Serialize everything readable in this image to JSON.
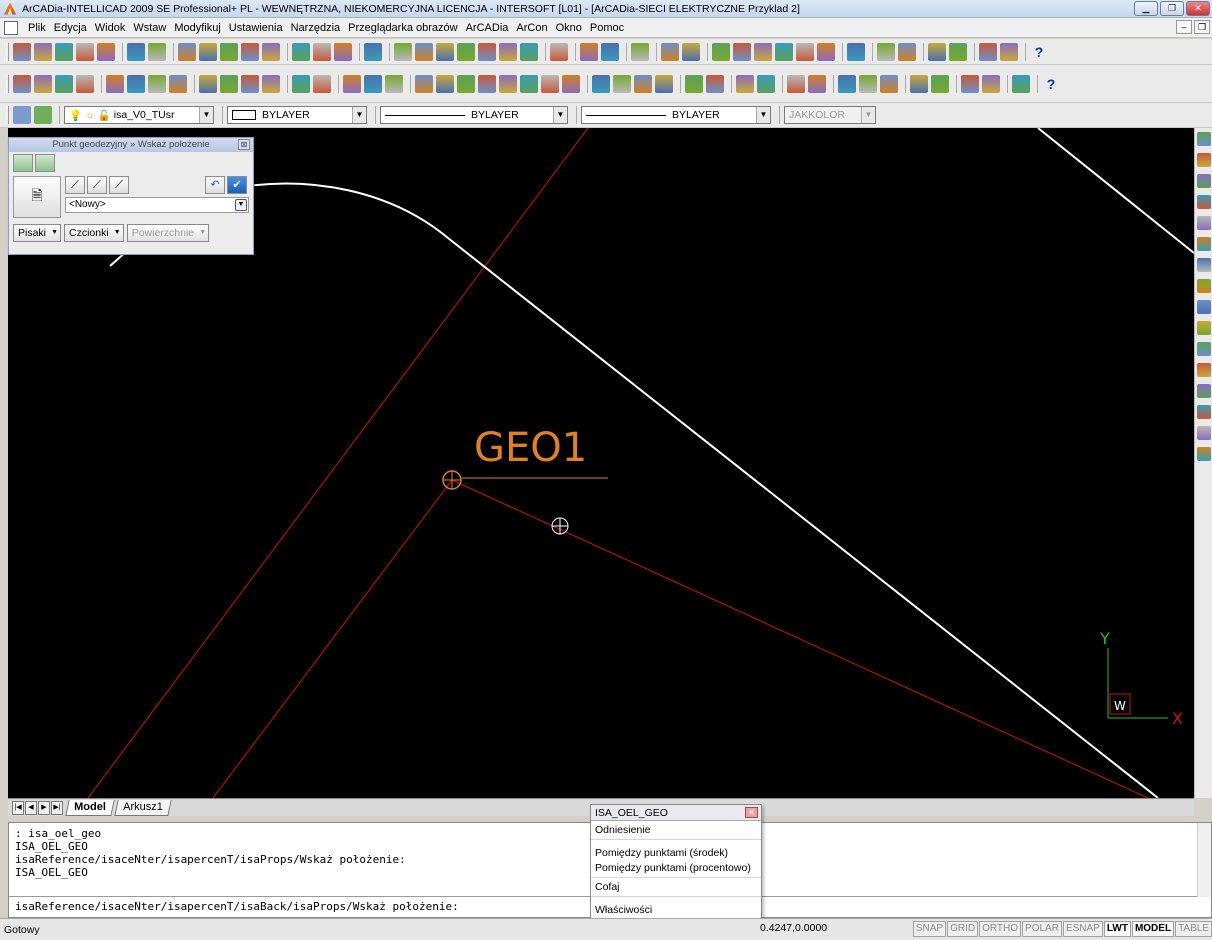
{
  "window": {
    "title": "ArCADia-INTELLICAD 2009 SE Professional+ PL - WEWNĘTRZNA, NIEKOMERCYJNA LICENCJA - INTERSOFT [L01] - [ArCADia-SIECI ELEKTRYCZNE Przyklad 2]",
    "min_label": "▁",
    "max_label": "❐",
    "close_label": "✕"
  },
  "menu": {
    "items": [
      "Plik",
      "Edycja",
      "Widok",
      "Wstaw",
      "Modyfikuj",
      "Ustawienia",
      "Narzędzia",
      "Przeglądarka obrazów",
      "ArCADia",
      "ArCon",
      "Okno",
      "Pomoc"
    ],
    "mdi_min": "–",
    "mdi_restore": "❐"
  },
  "toolbar4": {
    "layer_value": "isa_V0_TUsr",
    "color_value": "BYLAYER",
    "linetype_value": "BYLAYER",
    "lineweight_value": "BYLAYER",
    "plotstyle_value": "JAKKOLOR"
  },
  "float_panel": {
    "title": "Punkt geodezyjny » Wskaż położenie",
    "close": "⊠",
    "combo_value": "<Nowy>",
    "pisaki": "Pisaki",
    "czcionki": "Czcionki",
    "powierzchnie": "Powierzchnie",
    "undo_icon": "↶",
    "ok_icon": "✔"
  },
  "drawing": {
    "label": "GEO1",
    "ucs_y": "Y",
    "ucs_x": "X",
    "ucs_w": "W",
    "accent_red": "#d01010",
    "accent_orange": "#e08020"
  },
  "tabs": {
    "model": "Model",
    "sheet1": "Arkusz1"
  },
  "cmdline": {
    "history": [
      ": isa_oel_geo",
      "ISA_OEL_GEO",
      "isaReference/isaceNter/isapercenT/isaProps/Wskaż położenie:",
      "ISA_OEL_GEO"
    ],
    "prompt": "isaReference/isaceNter/isapercenT/isaBack/isaProps/Wskaż położenie:"
  },
  "popup": {
    "title": "ISA_OEL_GEO",
    "items": [
      "Odniesienie",
      "Pomiędzy punktami (środek)",
      "Pomiędzy punktami (procentowo)",
      "Cofaj",
      "Właściwości"
    ]
  },
  "status": {
    "text": "Gotowy",
    "coords": "0.4247,0.0000",
    "buttons": [
      "SNAP",
      "GRID",
      "ORTHO",
      "POLAR",
      "ESNAP",
      "LWT",
      "MODEL",
      "TABLE"
    ],
    "active_buttons": [
      "LWT",
      "MODEL"
    ]
  }
}
